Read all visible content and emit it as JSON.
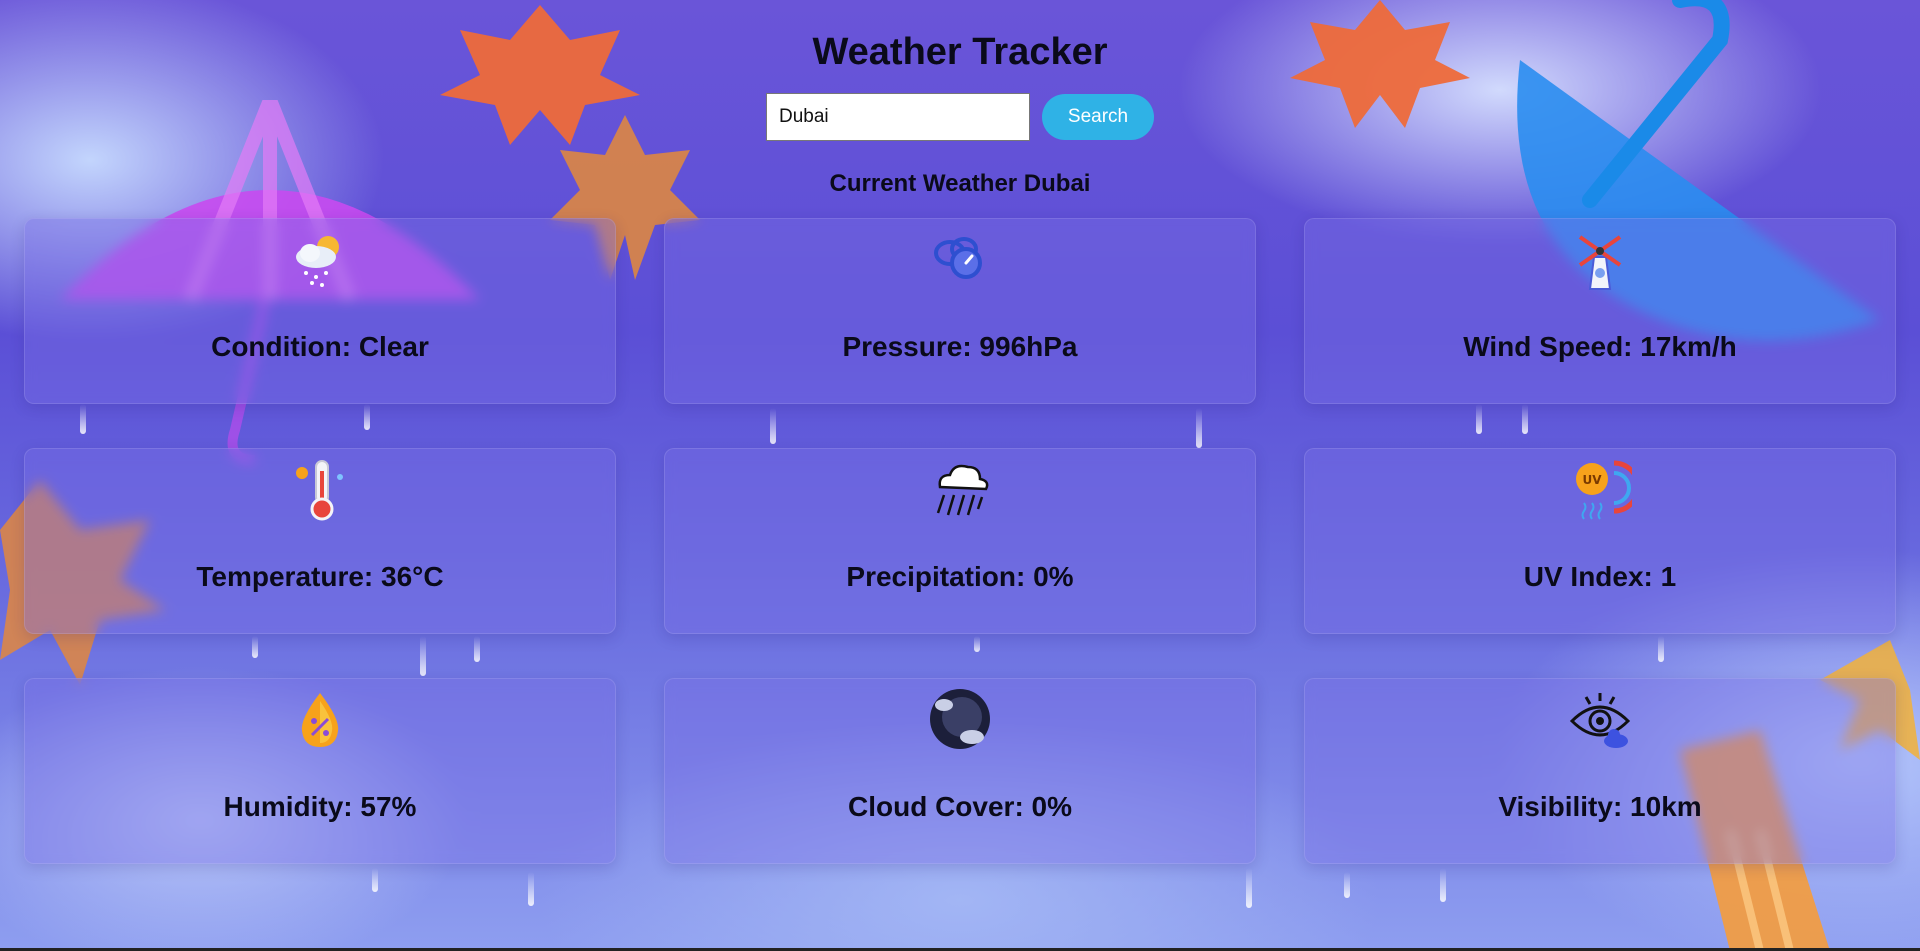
{
  "app": {
    "title": "Weather Tracker"
  },
  "search": {
    "value": "Dubai",
    "button_label": "Search"
  },
  "current": {
    "heading": "Current Weather Dubai"
  },
  "cards": [
    {
      "label": "Condition: Clear",
      "icon": "sun-cloud-snow-icon"
    },
    {
      "label": "Pressure: 996hPa",
      "icon": "pressure-gauge-icon"
    },
    {
      "label": "Wind Speed: 17km/h",
      "icon": "windmill-icon"
    },
    {
      "label": "Temperature: 36°C",
      "icon": "thermometer-icon"
    },
    {
      "label": "Precipitation: 0%",
      "icon": "rain-cloud-icon"
    },
    {
      "label": "UV Index: 1",
      "icon": "uv-sun-icon"
    },
    {
      "label": "Humidity: 57%",
      "icon": "humidity-drop-icon"
    },
    {
      "label": "Cloud Cover: 0%",
      "icon": "cloud-moon-icon"
    },
    {
      "label": "Visibility: 10km",
      "icon": "eye-cloud-icon"
    }
  ],
  "colors": {
    "accent": "#2fb2e6",
    "card_bg": "#786ee6",
    "text": "#0a0a1a"
  }
}
